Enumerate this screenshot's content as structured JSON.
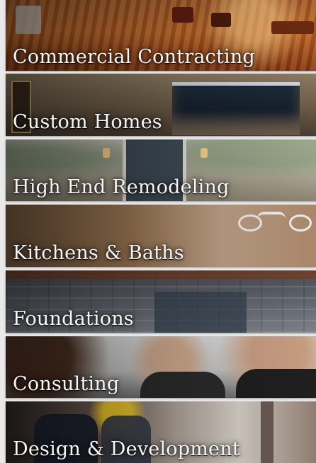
{
  "menu": {
    "items": [
      {
        "label": "Commercial Contracting"
      },
      {
        "label": "Custom Homes"
      },
      {
        "label": "High End Remodeling"
      },
      {
        "label": "Kitchens & Baths"
      },
      {
        "label": "Foundations"
      },
      {
        "label": "Consulting"
      },
      {
        "label": "Design & Development"
      }
    ]
  },
  "colors": {
    "label_text": "#f5f5f5",
    "page_background": "#e9e9e9"
  }
}
